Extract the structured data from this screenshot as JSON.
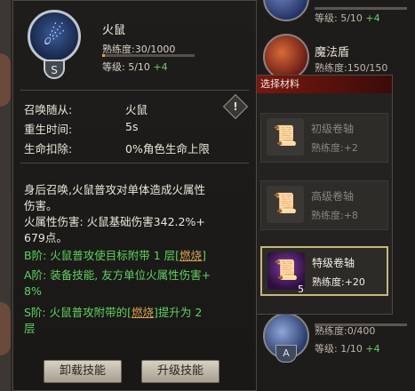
{
  "background": {
    "top_level": "等级: 5/10",
    "top_level_plus": "+4",
    "row2_name": "魔法盾",
    "row2_prof": "熟练度:150/150",
    "bottom_prof": "熟练度:0/400",
    "bottom_level": "等级: 1/10",
    "bottom_level_plus": "+4",
    "bottom_rank": "A"
  },
  "skill": {
    "name": "火鼠",
    "proficiency": "熟练度:30/1000",
    "proficiency_fraction": 0.03,
    "level": "等级: 5/10",
    "level_plus": "+4",
    "rank": "S",
    "icon": "fire-rat-icon"
  },
  "info": [
    {
      "label": "召唤随从:",
      "value": "火鼠"
    },
    {
      "label": "重生时间:",
      "value": "5s"
    },
    {
      "label": "生命扣除:",
      "value": "0%角色生命上限"
    }
  ],
  "description": {
    "line1": "身后召唤,火鼠普攻对单体造成火属性",
    "line2": "伤害。",
    "line3": "火属性伤害: 火鼠基础伤害342.2%+",
    "line4": "679点。",
    "b_pre": "B阶: 火鼠普攻使目标附带 1 层[",
    "b_kw": "燃烧",
    "b_post": "]",
    "a_line1": "A阶: 装备技能, 友方单位火属性伤害+",
    "a_line2": "8%",
    "s_pre": "S阶: 火鼠普攻附带的[",
    "s_kw": "燃烧",
    "s_post": "]提升为 2",
    "s_line2": "层"
  },
  "buttons": {
    "unequip": "卸载技能",
    "upgrade": "升级技能"
  },
  "materials": {
    "header": "选择材料",
    "items": [
      {
        "name": "初级卷轴",
        "prof": "熟练度:+2",
        "count": "",
        "selected": false
      },
      {
        "name": "高级卷轴",
        "prof": "熟练度:+8",
        "count": "",
        "selected": false
      },
      {
        "name": "特级卷轴",
        "prof": "熟练度:+20",
        "count": "5",
        "selected": true
      }
    ]
  },
  "colors": {
    "accent_green": "#5ed35e",
    "keyword": "#d7a54f",
    "header_red": "#7a1710",
    "selected_border": "#c9b676"
  }
}
